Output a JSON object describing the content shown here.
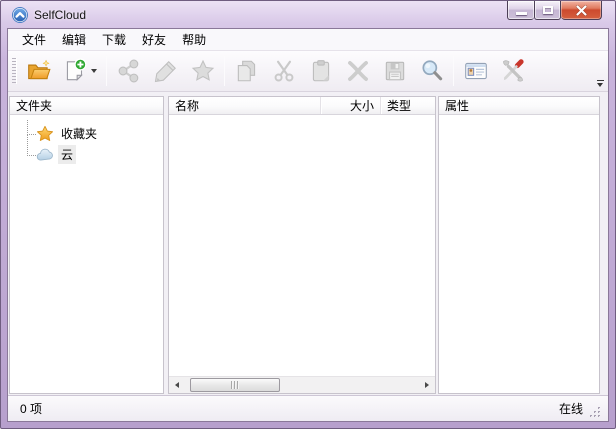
{
  "window": {
    "title": "SelfCloud"
  },
  "menu": {
    "items": [
      "文件",
      "编辑",
      "下载",
      "好友",
      "帮助"
    ]
  },
  "toolbar": {
    "buttons": [
      {
        "icon": "open-folder-icon",
        "enabled": true
      },
      {
        "icon": "new-item-icon",
        "enabled": true,
        "has_dropdown": true
      },
      {
        "icon": "share-icon",
        "enabled": false
      },
      {
        "icon": "edit-icon",
        "enabled": false
      },
      {
        "icon": "favorite-star-icon",
        "enabled": false
      },
      {
        "icon": "copy-icon",
        "enabled": false
      },
      {
        "icon": "cut-icon",
        "enabled": false
      },
      {
        "icon": "paste-icon",
        "enabled": false
      },
      {
        "icon": "delete-icon",
        "enabled": false
      },
      {
        "icon": "save-icon",
        "enabled": false
      },
      {
        "icon": "search-icon",
        "enabled": true
      },
      {
        "icon": "contacts-icon",
        "enabled": true
      },
      {
        "icon": "settings-icon",
        "enabled": true
      }
    ]
  },
  "folders_panel": {
    "header": "文件夹",
    "items": [
      {
        "label": "收藏夹",
        "icon": "star-icon",
        "selected": false
      },
      {
        "label": "云",
        "icon": "cloud-icon",
        "selected": true
      }
    ]
  },
  "files_panel": {
    "columns": [
      "名称",
      "大小",
      "类型"
    ]
  },
  "attributes_panel": {
    "header": "属性"
  },
  "statusbar": {
    "item_count": "0 项",
    "connection": "在线"
  },
  "colors": {
    "titlebar": "#cdb9df",
    "window_border": "#6f5d80",
    "close_button_red": "#cc4a2e",
    "folder_orange": "#f0a32c",
    "new_plus_green": "#2fa832",
    "star_gold": "#f6b231",
    "cloud_blue": "#c6dbec",
    "search_lens_blue": "#d7e9f8",
    "screwdriver_red": "#c9362c",
    "disabled_icon_grey": "#cdcdcd"
  }
}
